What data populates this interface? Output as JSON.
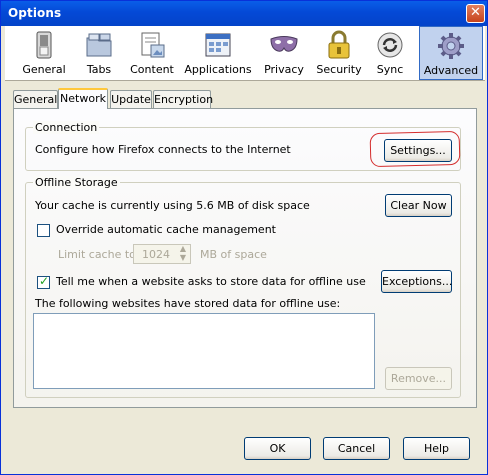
{
  "window": {
    "title": "Options",
    "close_glyph": "✕"
  },
  "toolbar": {
    "panes": [
      {
        "label": "General",
        "icon": "general-switch-icon"
      },
      {
        "label": "Tabs",
        "icon": "tabs-folder-icon"
      },
      {
        "label": "Content",
        "icon": "content-document-icon"
      },
      {
        "label": "Applications",
        "icon": "applications-window-icon"
      },
      {
        "label": "Privacy",
        "icon": "privacy-mask-icon"
      },
      {
        "label": "Security",
        "icon": "security-lock-icon"
      },
      {
        "label": "Sync",
        "icon": "sync-arrows-icon"
      },
      {
        "label": "Advanced",
        "icon": "advanced-gear-icon"
      }
    ],
    "selected": "Advanced"
  },
  "tabs": [
    "General",
    "Network",
    "Update",
    "Encryption"
  ],
  "active_tab": "Network",
  "connection": {
    "legend": "Connection",
    "description": "Configure how Firefox connects to the Internet",
    "settings_button": "Settings..."
  },
  "offline": {
    "legend": "Offline Storage",
    "cache_usage": "Your cache is currently using 5.6 MB of disk space",
    "clear_now_button": "Clear Now",
    "override_label": "Override automatic cache management",
    "override_checked": false,
    "limit_label": "Limit cache to",
    "limit_value": "1024",
    "limit_unit": "MB of space",
    "tell_me_label": "Tell me when a website asks to store data for offline use",
    "tell_me_checked": true,
    "exceptions_button": "Exceptions...",
    "stored_list_label": "The following websites have stored data for offline use:",
    "remove_button": "Remove..."
  },
  "footer": {
    "ok": "OK",
    "cancel": "Cancel",
    "help": "Help"
  },
  "colors": {
    "titlebar": "#0449D6",
    "selected_pane": "#C1D2EE",
    "highlight": "#D42D2D",
    "check": "#21A121"
  }
}
